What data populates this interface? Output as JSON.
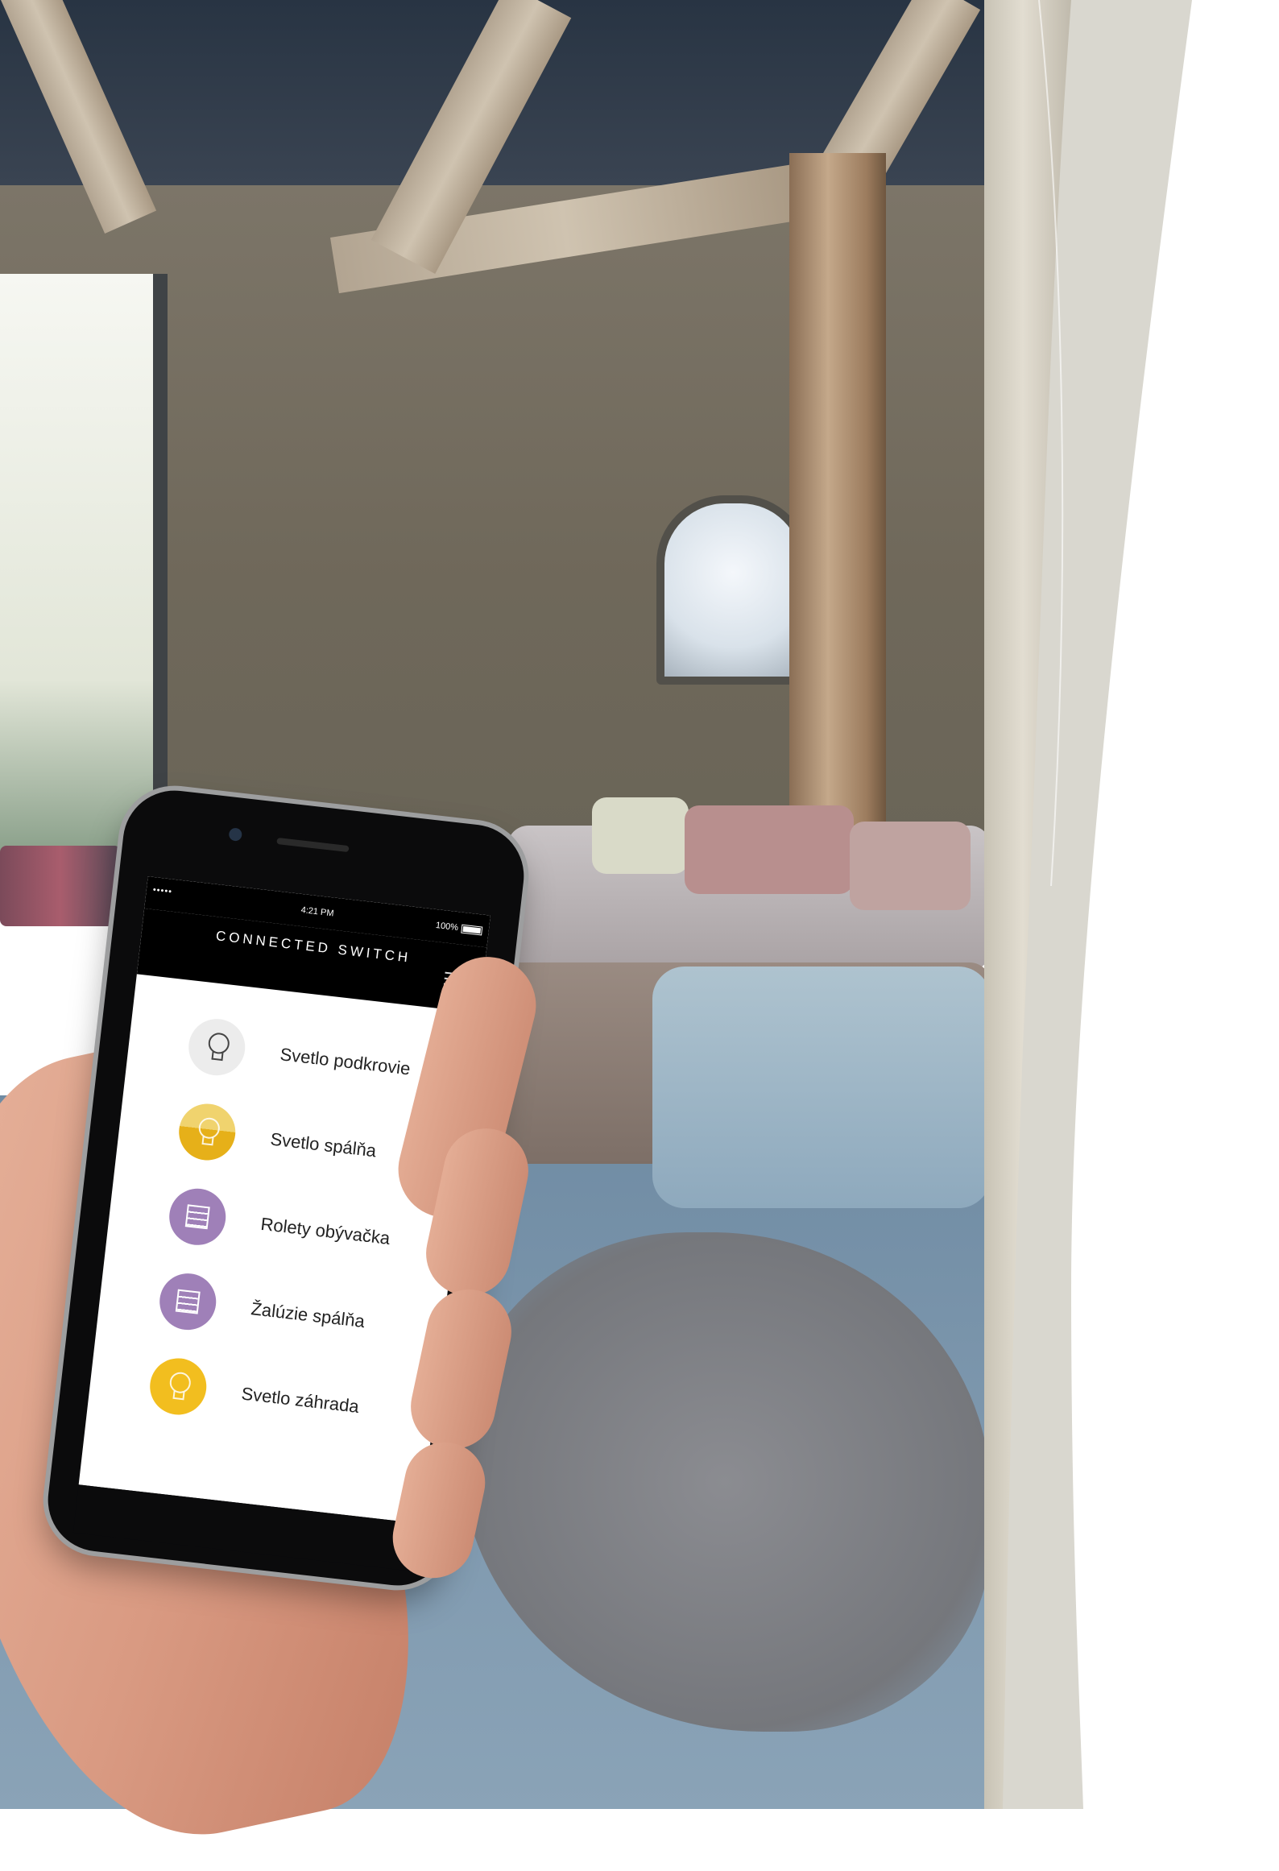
{
  "app": {
    "status_signal": "•••••",
    "status_time": "4:21 PM",
    "status_battery": "100%",
    "title": "CONNECTED SWITCH",
    "menu_icon": "hamburger-menu-icon"
  },
  "devices": [
    {
      "label": "Svetlo podkrovie",
      "icon": "lightbulb-icon",
      "state": "off",
      "color": "#ECECEC"
    },
    {
      "label": "Svetlo spálňa",
      "icon": "lightbulb-icon",
      "state": "dimmed",
      "color": "#E9B521"
    },
    {
      "label": "Rolety obývačka",
      "icon": "blinds-icon",
      "state": "shutter",
      "color": "#9F80B8"
    },
    {
      "label": "Žalúzie spálňa",
      "icon": "blinds-icon",
      "state": "shutter",
      "color": "#9F80B8"
    },
    {
      "label": "Svetlo záhrada",
      "icon": "lightbulb-icon",
      "state": "on",
      "color": "#F2BE1F"
    }
  ]
}
